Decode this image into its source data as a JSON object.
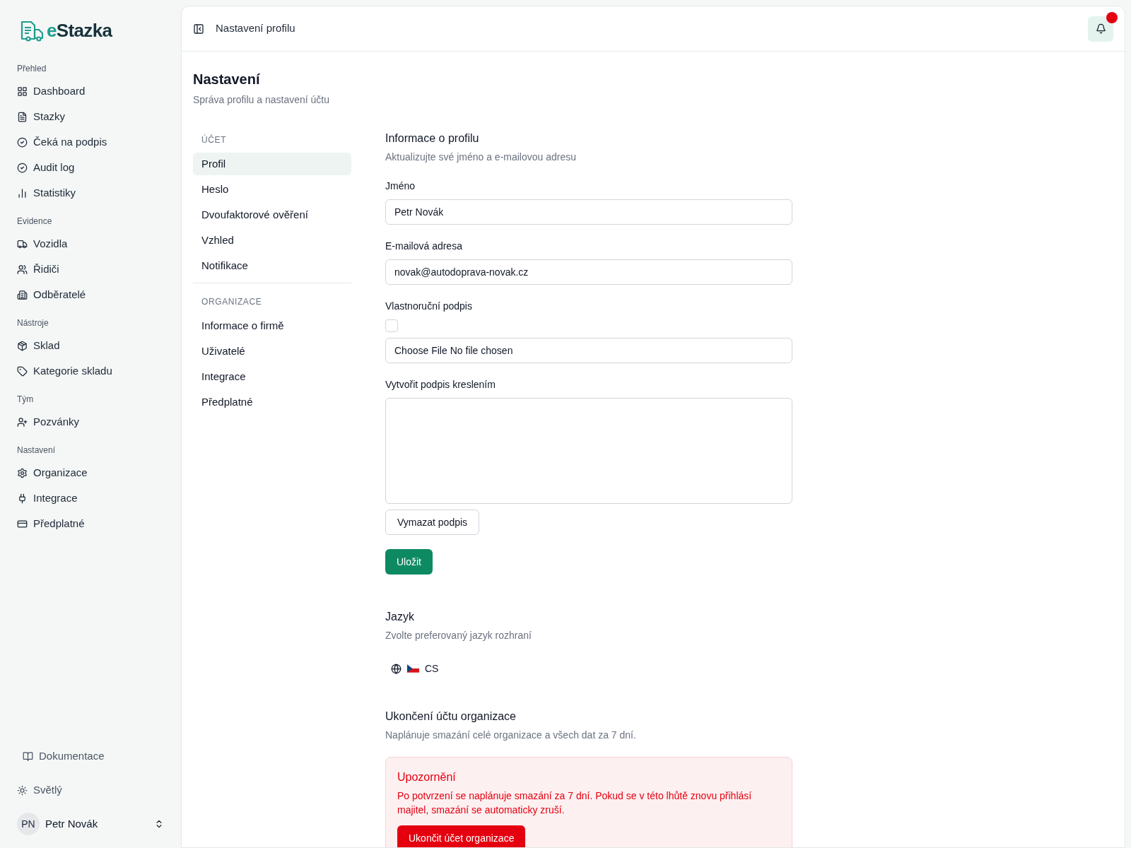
{
  "sidebar": {
    "logo": {
      "prefix": "e",
      "name": "Stazka"
    },
    "sections": [
      {
        "title": "Přehled",
        "items": [
          {
            "label": "Dashboard"
          },
          {
            "label": "Stazky"
          },
          {
            "label": "Čeká na podpis"
          },
          {
            "label": "Audit log"
          },
          {
            "label": "Statistiky"
          }
        ]
      },
      {
        "title": "Evidence",
        "items": [
          {
            "label": "Vozidla"
          },
          {
            "label": "Řidiči"
          },
          {
            "label": "Odběratelé"
          }
        ]
      },
      {
        "title": "Nástroje",
        "items": [
          {
            "label": "Sklad"
          },
          {
            "label": "Kategorie skladu"
          }
        ]
      },
      {
        "title": "Tým",
        "items": [
          {
            "label": "Pozvánky"
          }
        ]
      },
      {
        "title": "Nastavení",
        "items": [
          {
            "label": "Organizace"
          },
          {
            "label": "Integrace"
          },
          {
            "label": "Předplatné"
          }
        ]
      }
    ],
    "docs": "Dokumentace",
    "theme": "Světlý",
    "user": {
      "initials": "PN",
      "name": "Petr Novák"
    }
  },
  "header": {
    "title": "Nastavení profilu",
    "notifications_unread": true
  },
  "page": {
    "title": "Nastavení",
    "subtitle": "Správa profilu a nastavení účtu"
  },
  "settings_nav": [
    {
      "heading": "ÚČET",
      "items": [
        {
          "label": "Profil",
          "selected": true
        },
        {
          "label": "Heslo",
          "selected": false
        },
        {
          "label": "Dvoufaktorové ověření",
          "selected": false
        },
        {
          "label": "Vzhled",
          "selected": false
        },
        {
          "label": "Notifikace",
          "selected": false
        }
      ]
    },
    {
      "heading": "ORGANIZACE",
      "items": [
        {
          "label": "Informace o firmě",
          "selected": false
        },
        {
          "label": "Uživatelé",
          "selected": false
        },
        {
          "label": "Integrace",
          "selected": false
        },
        {
          "label": "Předplatné",
          "selected": false
        }
      ]
    }
  ],
  "profile": {
    "title": "Informace o profilu",
    "subtitle": "Aktualizujte své jméno a e-mailovou adresu",
    "name": {
      "label": "Jméno",
      "value": "Petr Novák"
    },
    "email": {
      "label": "E-mailová adresa",
      "value": "novak@autodoprava-novak.cz"
    },
    "signature": {
      "label": "Vlastnoruční podpis",
      "checked": false,
      "file_button": "Choose File",
      "file_status": "No file chosen"
    },
    "drawing": {
      "label": "Vytvořit podpis kreslením",
      "clear_button": "Vymazat podpis"
    },
    "save_button": "Uložit"
  },
  "language": {
    "title": "Jazyk",
    "subtitle": "Zvolte preferovaný jazyk rozhraní",
    "value": "CS"
  },
  "danger": {
    "title": "Ukončení účtu organizace",
    "subtitle": "Naplánuje smazání celé organizace a všech dat za 7 dní.",
    "warning_title": "Upozornění",
    "warning_text": "Po potvrzení se naplánuje smazání za 7 dní. Pokud se v této lhůtě znovu přihlásí majitel, smazání se automaticky zruší.",
    "button": "Ukončit účet organizace"
  }
}
